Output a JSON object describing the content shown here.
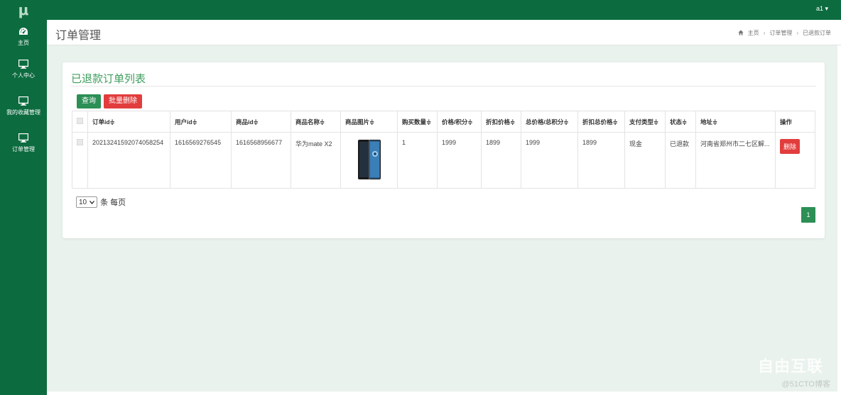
{
  "app": {
    "logo": "μ"
  },
  "sidebar": {
    "items": [
      {
        "label": "主页",
        "icon": "dashboard-icon"
      },
      {
        "label": "个人中心",
        "icon": "monitor-icon"
      },
      {
        "label": "我的收藏管理",
        "icon": "monitor-icon"
      },
      {
        "label": "订单管理",
        "icon": "monitor-icon"
      }
    ]
  },
  "topbar": {
    "user": "a1 ▾"
  },
  "header": {
    "title": "订单管理",
    "breadcrumb": [
      "主页",
      "订单管理",
      "已退款订单"
    ],
    "breadcrumb_sep": "›"
  },
  "panel": {
    "title": "已退款订单列表",
    "query_label": "查询",
    "batch_delete_label": "批量删除"
  },
  "table": {
    "columns": [
      "订单id≑",
      "用户id≑",
      "商品id≑",
      "商品名称≑",
      "商品图片≑",
      "购买数量≑",
      "价格/积分≑",
      "折扣价格≑",
      "总价格/总积分≑",
      "折扣总价格≑",
      "支付类型≑",
      "状态≑",
      "地址≑",
      "操作"
    ],
    "rows": [
      {
        "order_id": "20213241592074058254",
        "user_id": "1616569276545",
        "goods_id": "1616568956677",
        "goods_name": "华为mate X2",
        "quantity": "1",
        "price": "1999",
        "discount_price": "1899",
        "total_price": "1999",
        "discount_total": "1899",
        "pay_type": "现金",
        "status": "已退款",
        "address": "河南省郑州市二七区解...",
        "delete_label": "删除"
      }
    ]
  },
  "pagination": {
    "page_size": "10",
    "page_size_suffix": "条 每页",
    "current_page": "1"
  },
  "watermark": {
    "brand": "自由互联",
    "site": "@51CTO博客"
  },
  "colors": {
    "primary": "#0c6b3f",
    "accent": "#2c8f55",
    "danger": "#e23d3d",
    "background": "#e9f2ec"
  }
}
